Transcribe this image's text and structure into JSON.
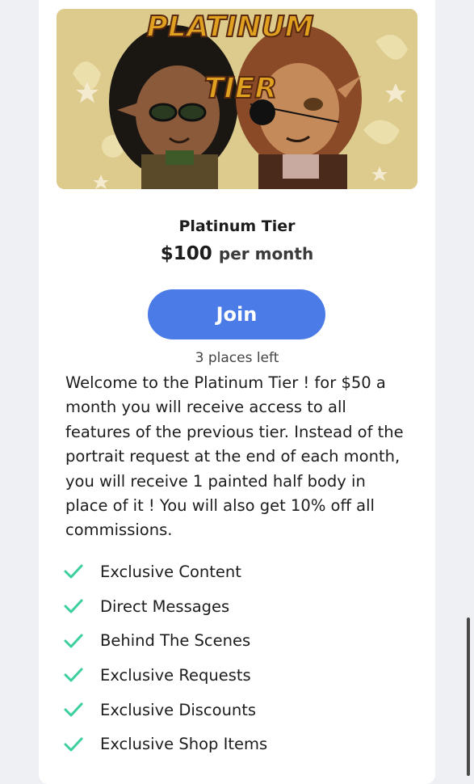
{
  "tier": {
    "banner_title_line1": "PLATINUM",
    "banner_title_line2": "TIER",
    "name": "Platinum Tier",
    "price": "$100",
    "period": "per month",
    "join_label": "Join",
    "places_left": "3 places left",
    "description": "Welcome to the Platinum Tier ! for $50 a month you will receive access to all features of the previous tier. Instead of the portrait request at the end of each month, you will receive 1 painted half body in place of it ! You will also get 10% off all commissions."
  },
  "benefits": [
    {
      "label": "Exclusive Content",
      "icon": "check-icon"
    },
    {
      "label": "Direct Messages",
      "icon": "check-icon"
    },
    {
      "label": "Behind The Scenes",
      "icon": "check-icon"
    },
    {
      "label": "Exclusive Requests",
      "icon": "check-icon"
    },
    {
      "label": "Exclusive Discounts",
      "icon": "check-icon"
    },
    {
      "label": "Exclusive Shop Items",
      "icon": "check-icon"
    }
  ],
  "colors": {
    "accent": "#4a7be6",
    "check": "#3ccf9e",
    "banner_bg": "#d9c98a"
  }
}
